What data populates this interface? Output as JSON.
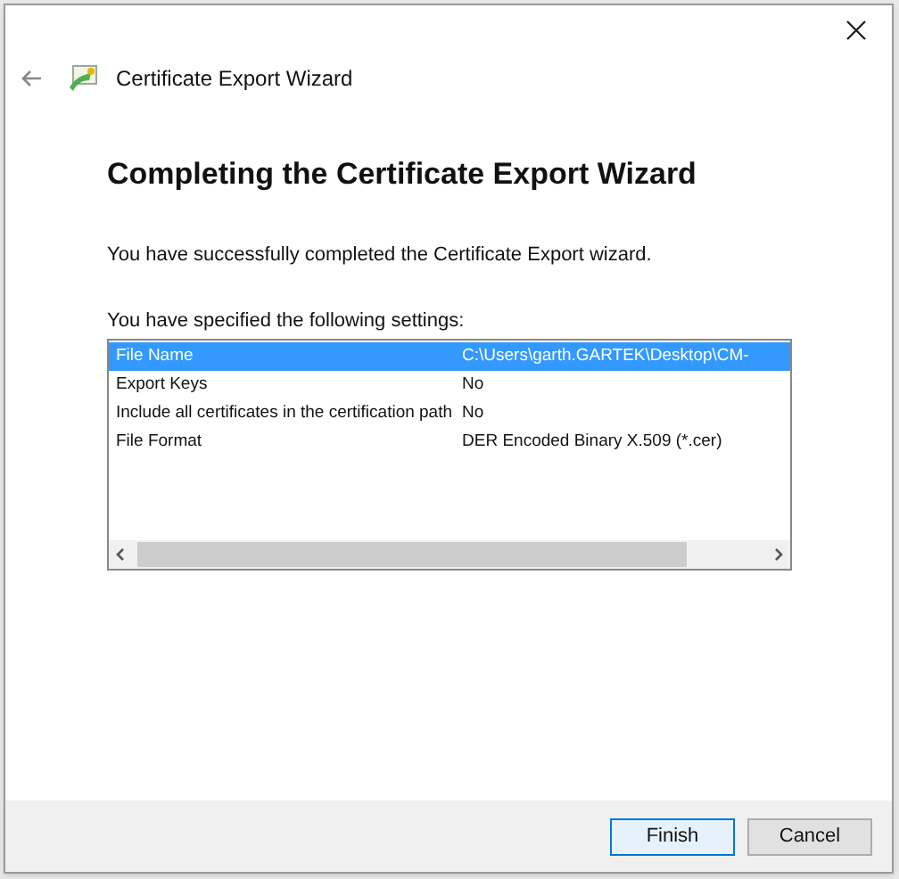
{
  "window": {
    "title": "Certificate Export Wizard"
  },
  "heading": "Completing the Certificate Export Wizard",
  "message": "You have successfully completed the Certificate Export wizard.",
  "settings_label": "You have specified the following settings:",
  "settings": [
    {
      "name": "File Name",
      "value": "C:\\Users\\garth.GARTEK\\Desktop\\CM-",
      "selected": true
    },
    {
      "name": "Export Keys",
      "value": "No",
      "selected": false
    },
    {
      "name": "Include all certificates in the certification path",
      "value": "No",
      "selected": false
    },
    {
      "name": "File Format",
      "value": "DER Encoded Binary X.509 (*.cer)",
      "selected": false
    }
  ],
  "buttons": [
    {
      "label": "Finish",
      "kind": "default"
    },
    {
      "label": "Cancel",
      "kind": "normal"
    }
  ]
}
